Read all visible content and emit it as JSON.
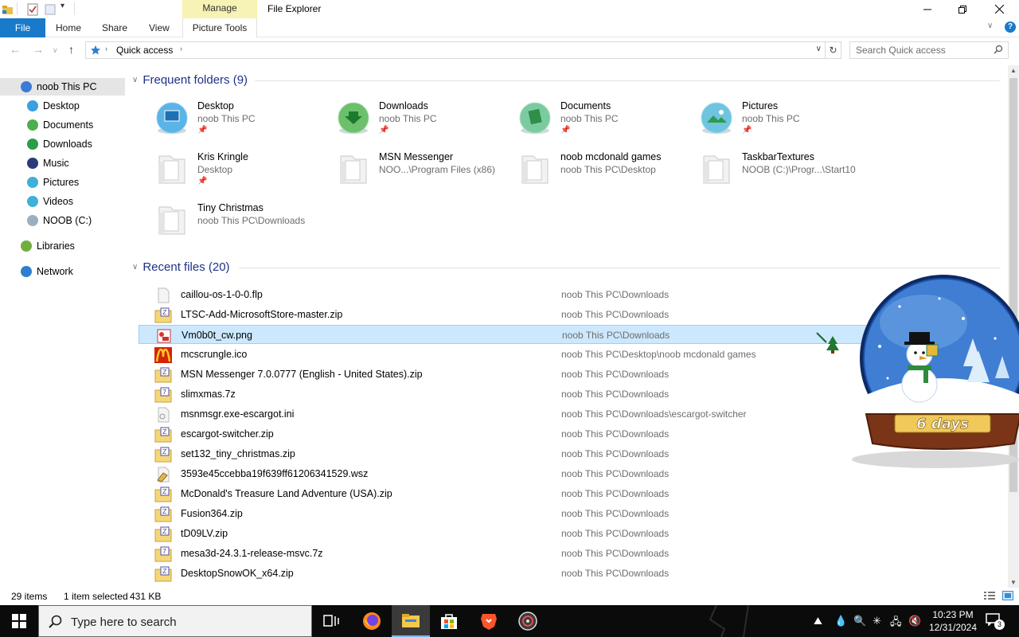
{
  "window": {
    "title": "File Explorer",
    "manage_label": "Manage",
    "ribbon_tabs": [
      "File",
      "Home",
      "Share",
      "View",
      "Picture Tools"
    ]
  },
  "address": {
    "path": "Quick access",
    "search_placeholder": "Search Quick access"
  },
  "nav": [
    {
      "label": "noob This PC",
      "color": "#3a7bd5"
    },
    {
      "label": "Desktop",
      "color": "#3aa0e0"
    },
    {
      "label": "Documents",
      "color": "#4cae4c"
    },
    {
      "label": "Downloads",
      "color": "#2e9b4a"
    },
    {
      "label": "Music",
      "color": "#2a3a7a"
    },
    {
      "label": "Pictures",
      "color": "#3fb0d8"
    },
    {
      "label": "Videos",
      "color": "#3fb0d8"
    },
    {
      "label": "NOOB (C:)",
      "color": "#9ab0c0"
    },
    {
      "label": "Libraries",
      "color": "#6fae3f"
    },
    {
      "label": "Network",
      "color": "#2f7fd0"
    }
  ],
  "frequent": {
    "title": "Frequent folders (9)",
    "items": [
      {
        "name": "Desktop",
        "path": "noob This PC",
        "pinned": true,
        "icon": "desktop-globe"
      },
      {
        "name": "Downloads",
        "path": "noob This PC",
        "pinned": true,
        "icon": "downloads-globe"
      },
      {
        "name": "Documents",
        "path": "noob This PC",
        "pinned": true,
        "icon": "documents-globe"
      },
      {
        "name": "Pictures",
        "path": "noob This PC",
        "pinned": true,
        "icon": "pictures-globe"
      },
      {
        "name": "Kris Kringle",
        "path": "Desktop",
        "pinned": true,
        "icon": "folder"
      },
      {
        "name": "MSN Messenger",
        "path": "NOO...\\Program Files (x86)",
        "pinned": false,
        "icon": "folder"
      },
      {
        "name": "noob mcdonald games",
        "path": "noob This PC\\Desktop",
        "pinned": false,
        "icon": "folder"
      },
      {
        "name": "TaskbarTextures",
        "path": "NOOB (C:)\\Progr...\\Start10",
        "pinned": false,
        "icon": "folder"
      },
      {
        "name": "Tiny Christmas",
        "path": "noob This PC\\Downloads",
        "pinned": false,
        "icon": "folder"
      }
    ]
  },
  "recent": {
    "title": "Recent files (20)",
    "items": [
      {
        "name": "caillou-os-1-0-0.flp",
        "loc": "noob This PC\\Downloads",
        "icon": "blank-file"
      },
      {
        "name": "LTSC-Add-MicrosoftStore-master.zip",
        "loc": "noob This PC\\Downloads",
        "icon": "zip"
      },
      {
        "name": "Vm0b0t_cw.png",
        "loc": "noob This PC\\Downloads",
        "icon": "png",
        "selected": true
      },
      {
        "name": "mcscrungle.ico",
        "loc": "noob This PC\\Desktop\\noob mcdonald games",
        "icon": "mcdonalds"
      },
      {
        "name": "MSN Messenger 7.0.0777 (English - United States).zip",
        "loc": "noob This PC\\Downloads",
        "icon": "zip"
      },
      {
        "name": "slimxmas.7z",
        "loc": "noob This PC\\Downloads",
        "icon": "7z"
      },
      {
        "name": "msnmsgr.exe-escargot.ini",
        "loc": "noob This PC\\Downloads\\escargot-switcher",
        "icon": "ini"
      },
      {
        "name": "escargot-switcher.zip",
        "loc": "noob This PC\\Downloads",
        "icon": "zip"
      },
      {
        "name": "set132_tiny_christmas.zip",
        "loc": "noob This PC\\Downloads",
        "icon": "zip"
      },
      {
        "name": "3593e45ccebba19f639ff61206341529.wsz",
        "loc": "noob This PC\\Downloads",
        "icon": "wsz"
      },
      {
        "name": "McDonald's Treasure Land Adventure (USA).zip",
        "loc": "noob This PC\\Downloads",
        "icon": "zip"
      },
      {
        "name": "Fusion364.zip",
        "loc": "noob This PC\\Downloads",
        "icon": "zip"
      },
      {
        "name": "tD09LV.zip",
        "loc": "noob This PC\\Downloads",
        "icon": "zip"
      },
      {
        "name": "mesa3d-24.3.1-release-msvc.7z",
        "loc": "noob This PC\\Downloads",
        "icon": "7z"
      },
      {
        "name": "DesktopSnowOK_x64.zip",
        "loc": "noob This PC\\Downloads",
        "icon": "zip"
      }
    ]
  },
  "status": {
    "items": "29 items",
    "selected": "1 item selected",
    "size": "431 KB"
  },
  "gadget": {
    "days": "6 days"
  },
  "taskbar": {
    "search_placeholder": "Type here to search",
    "time": "10:23 PM",
    "date": "12/31/2024",
    "notifications": "3"
  }
}
